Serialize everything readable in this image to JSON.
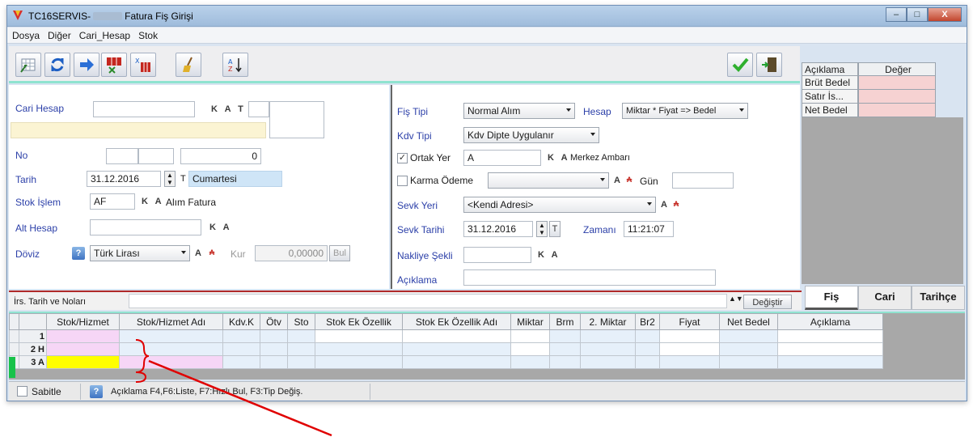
{
  "window": {
    "title_prefix": "TC16SERVIS-",
    "title_suffix": "Fatura Fiş Girişi",
    "min": "–",
    "max": "□",
    "close": "X"
  },
  "menu": [
    "Dosya",
    "Diğer",
    "Cari_Hesap",
    "Stok"
  ],
  "toolbar": {
    "icons": [
      "grid-icon",
      "refresh-icon",
      "arrow-right-icon",
      "table-x-icon",
      "table-sort-icon",
      "broom-icon",
      "sort-az-icon",
      "check-icon",
      "exit-door-icon"
    ]
  },
  "summary_table": {
    "headers": [
      "Açıklama",
      "Değer"
    ],
    "rows": [
      {
        "label": "Brüt Bedel",
        "value": ""
      },
      {
        "label": "Satır İs...",
        "value": ""
      },
      {
        "label": "Net Bedel",
        "value": ""
      }
    ]
  },
  "left_form": {
    "cari_hesap_label": "Cari Hesap",
    "cari_hesap_value": "",
    "ka_t": "K A T",
    "no_label": "No",
    "no_number": "0",
    "tarih_label": "Tarih",
    "tarih_value": "31.12.2016",
    "tarih_t": "T",
    "tarih_day": "Cumartesi",
    "stok_islem_label": "Stok İşlem",
    "stok_islem_value": "AF",
    "stok_islem_ka": "K A",
    "stok_islem_desc": "Alım Fatura",
    "alt_hesap_label": "Alt Hesap",
    "alt_hesap_ka": "K A",
    "doviz_label": "Döviz",
    "doviz_value": "Türk Lirası",
    "doviz_a": "A",
    "kur_label": "Kur",
    "kur_value": "0,00000",
    "bul_label": "Bul"
  },
  "mid_form": {
    "fis_tipi_label": "Fiş Tipi",
    "fis_tipi_value": "Normal Alım",
    "hesap_label": "Hesap",
    "hesap_value": "Miktar * Fiyat => Bedel",
    "kdv_tipi_label": "Kdv Tipi",
    "kdv_tipi_value": "Kdv Dipte Uygulanır",
    "ortak_yer_label": "Ortak Yer",
    "ortak_yer_checked": true,
    "ortak_yer_value": "A",
    "ortak_yer_ka": "K A",
    "ortak_yer_desc": "Merkez Ambarı",
    "karma_odeme_label": "Karma Ödeme",
    "karma_a": "A",
    "gun_label": "Gün",
    "sevk_yeri_label": "Sevk Yeri",
    "sevk_yeri_value": "<Kendi Adresi>",
    "sevk_a": "A",
    "sevk_tarihi_label": "Sevk Tarihi",
    "sevk_tarihi_value": "31.12.2016",
    "sevk_t": "T",
    "zamani_label": "Zamanı",
    "zamani_value": "11:21:07",
    "nakliye_label": "Nakliye Şekli",
    "nakliye_ka": "K A",
    "aciklama_label": "Açıklama"
  },
  "irs_bar": {
    "label": "İrs. Tarih ve Noları",
    "button": "Değiştir"
  },
  "tabs": [
    "Fiş",
    "Cari",
    "Tarihçe"
  ],
  "grid": {
    "columns": [
      "Stok/Hizmet",
      "Stok/Hizmet Adı",
      "Kdv.K",
      "Ötv",
      "Sto",
      "Stok Ek Özellik",
      "Stok Ek Özellik Adı",
      "Miktar",
      "Brm",
      "2. Miktar",
      "Br2",
      "Fiyat",
      "Net Bedel",
      "Açıklama"
    ],
    "rows": [
      {
        "num": "1",
        "code": ""
      },
      {
        "num": "2",
        "code": "H"
      },
      {
        "num": "3",
        "code": "A"
      }
    ]
  },
  "status": {
    "sabitle_label": "Sabitle",
    "help_text": "Açıklama F4,F6:Liste, F7:Hızlı Bul, F3:Tip Değiş."
  },
  "colors": {
    "label_blue": "#2b3fa8",
    "pink_cell": "#f6d2d2",
    "yellow_cell": "#ffff00",
    "accent_teal": "#8fe3d0",
    "annotation_red": "#e00000"
  }
}
